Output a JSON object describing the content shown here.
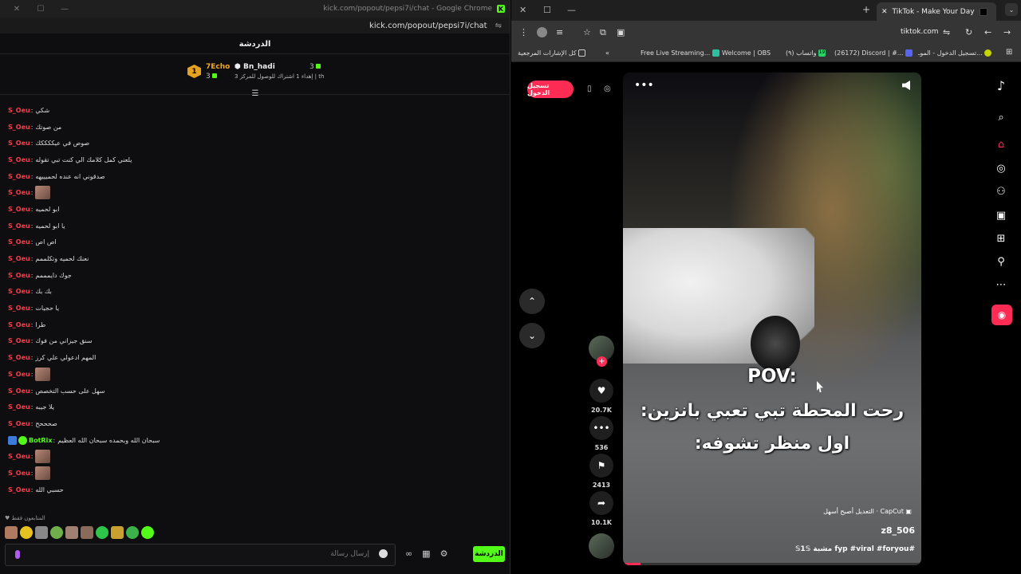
{
  "left_window": {
    "title": "kick.com/popout/pepsi7i/chat - Google Chrome",
    "url": "kick.com/popout/pepsi7i/chat",
    "chat_title": "الدردشة",
    "gifters": {
      "first": {
        "rank": "1",
        "name": "7Echo",
        "count": "3"
      },
      "second": {
        "name": "Bn_hadi",
        "count": "3",
        "sub": "إهداء 1 اشتراك للوصول للمركز 3 | th"
      }
    },
    "messages": [
      {
        "user": "S_Oeu",
        "text": "شكي"
      },
      {
        "user": "S_Oeu",
        "text": "من صوتك"
      },
      {
        "user": "S_Oeu",
        "text": "صوص في عيككككك"
      },
      {
        "user": "S_Oeu",
        "text": "يلعني كمل كلامك الي كنت تبي تقوله"
      },
      {
        "user": "S_Oeu",
        "text": "صدقوني انه عنده لحميييهه"
      },
      {
        "user": "S_Oeu",
        "text": "",
        "emote": "peepo-emote"
      },
      {
        "user": "S_Oeu",
        "text": "ابو لحميه"
      },
      {
        "user": "S_Oeu",
        "text": "يا ابو لحميه"
      },
      {
        "user": "S_Oeu",
        "text": "اص اص"
      },
      {
        "user": "S_Oeu",
        "text": "نعنك لحميه وتكلممم"
      },
      {
        "user": "S_Oeu",
        "text": "جوك دايمممم"
      },
      {
        "user": "S_Oeu",
        "text": "بك بك"
      },
      {
        "user": "S_Oeu",
        "text": "يا حجيات"
      },
      {
        "user": "S_Oeu",
        "text": "طرا"
      },
      {
        "user": "S_Oeu",
        "text": "سنق جيزاني من فوك"
      },
      {
        "user": "S_Oeu",
        "text": "المهم ادعولي علي كرز"
      },
      {
        "user": "S_Oeu",
        "text": "",
        "emote": "peepo-emote"
      },
      {
        "user": "S_Oeu",
        "text": "سهل على حسب التخصص"
      },
      {
        "user": "S_Oeu",
        "text": "يلا جيبه"
      },
      {
        "user": "S_Oeu",
        "text": "صحححح"
      },
      {
        "user": "BotRix",
        "text": "سبحان الله وبحمده سبحان الله العظيم",
        "bot": true
      },
      {
        "user": "S_Oeu",
        "text": "",
        "emote": "peepo-emote"
      },
      {
        "user": "S_Oeu",
        "text": "",
        "emote": "peepo-emote"
      },
      {
        "user": "S_Oeu",
        "text": "حسبي الله"
      }
    ],
    "followers_only": "المتابعون فقط",
    "input_placeholder": "إرسال رسالة",
    "chat_button": "الدردشة"
  },
  "right_window": {
    "tab_title": "TikTok - Make Your Day",
    "url": "tiktok.com",
    "bookmarks": [
      "كل الإشارات المرجعية",
      "Free Live Streaming...",
      "Welcome | OBS",
      "واتساب (٩)",
      "(26172) Discord | #...",
      "تسجيل الدخول - الموـ..."
    ],
    "whatsapp_count": "19",
    "login_button": "تسجيل الدخول",
    "video": {
      "overlay_pov": "POV:",
      "overlay_line1": "رحت المحطة تبي تعبي بانزين:",
      "overlay_line2": "اول منظر تشوفه:",
      "capcut": "CapCut · التعديل أصبح أسهل",
      "author": "z8_506",
      "caption": "#fyp #viral #foryou مشبة 𝕊1𝕊",
      "progress": 0.06
    },
    "actions": {
      "likes": "20.7K",
      "comments": "536",
      "saves": "2413",
      "shares": "10.1K"
    }
  }
}
